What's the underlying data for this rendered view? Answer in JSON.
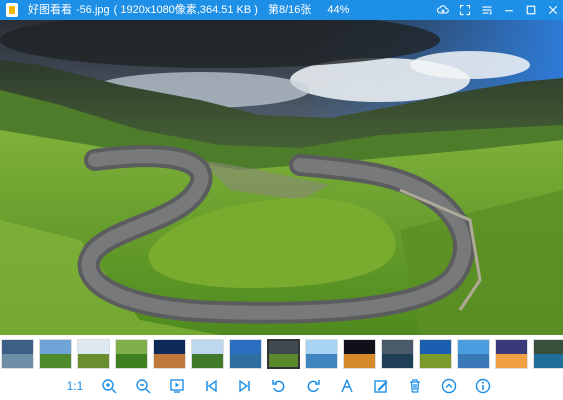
{
  "window": {
    "app_name": "好图看看",
    "file_name": "-56.jpg",
    "info": "( 1920x1080像素,364.51 KB )",
    "count": "第8/16张",
    "zoom": "44%"
  },
  "title_buttons": [
    "cloud-icon",
    "fullscreen-icon",
    "menu-icon",
    "minimize-icon",
    "maximize-icon",
    "close-icon"
  ],
  "thumbnails": [
    {
      "sky": "#3b5f86",
      "land": "#6f8fa8"
    },
    {
      "sky": "#6fa4d6",
      "land": "#4f8a2a"
    },
    {
      "sky": "#dfe9f2",
      "land": "#6a8d2f"
    },
    {
      "sky": "#7fb04a",
      "land": "#3f7f1f"
    },
    {
      "sky": "#0e2a58",
      "land": "#c0783a"
    },
    {
      "sky": "#bcd7ee",
      "land": "#3f7a2a"
    },
    {
      "sky": "#2a6fc2",
      "land": "#2f6fa0"
    },
    {
      "sky": "#404a52",
      "land": "#5b8a2d",
      "active": true
    },
    {
      "sky": "#a9d3f2",
      "land": "#3f86c0"
    },
    {
      "sky": "#101018",
      "land": "#d78a2a"
    },
    {
      "sky": "#4a5a6a",
      "land": "#1f3f56"
    },
    {
      "sky": "#1a5fb0",
      "land": "#7a9a2a"
    },
    {
      "sky": "#4a9ee0",
      "land": "#3a78b8"
    },
    {
      "sky": "#3a3a7a",
      "land": "#f0a040"
    },
    {
      "sky": "#384f3a",
      "land": "#1f6f9a"
    }
  ],
  "toolbar": {
    "actual_size_label": "1:1",
    "tools": [
      "zoom-in-icon",
      "zoom-out-icon",
      "slideshow-icon",
      "prev-icon",
      "next-icon",
      "rotate-left-icon",
      "rotate-right-icon",
      "compare-icon",
      "edit-icon",
      "delete-icon",
      "up-icon",
      "info-icon"
    ]
  },
  "colors": {
    "accent": "#1e8fe6",
    "titlebar": "#1e8fe6"
  }
}
